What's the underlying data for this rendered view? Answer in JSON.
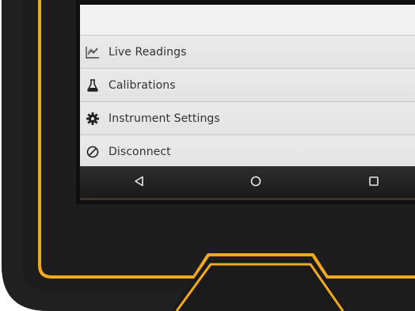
{
  "colors": {
    "frame_accent": "#f2a91d",
    "frame_body": "#1c1c1c",
    "screen_bg": "#e9e9e9",
    "text": "#333333",
    "navbar": "#1f1f1f"
  },
  "menu": {
    "items": [
      {
        "label": "Live Readings",
        "icon": "chart-icon"
      },
      {
        "label": "Calibrations",
        "icon": "flask-icon"
      },
      {
        "label": "Instrument Settings",
        "icon": "gear-icon"
      },
      {
        "label": "Disconnect",
        "icon": "disconnect-icon"
      }
    ]
  },
  "navbar": {
    "buttons": [
      {
        "name": "back",
        "icon": "back-triangle-icon"
      },
      {
        "name": "home",
        "icon": "home-circle-icon"
      },
      {
        "name": "recents",
        "icon": "recents-square-icon"
      }
    ]
  }
}
